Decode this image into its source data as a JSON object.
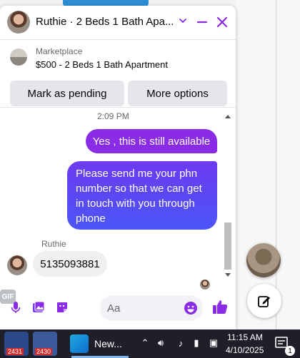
{
  "chat": {
    "title": "Ruthie · 2 Beds 1 Bath Apa...",
    "listing": {
      "source": "Marketplace",
      "title": "$500 - 2 Beds 1 Bath Apartment",
      "mark_pending_label": "Mark as pending",
      "more_options_label": "More options"
    },
    "timestamp": "2:09 PM",
    "messages": [
      {
        "direction": "outgoing",
        "text": "Yes , this is still available"
      },
      {
        "direction": "outgoing",
        "text": "Please send me your phn number so that we can get in touch with you through phone"
      },
      {
        "direction": "incoming",
        "sender": "Ruthie",
        "text": "5135093881"
      }
    ],
    "composer": {
      "placeholder": "Aa",
      "gif_label": "GIF"
    },
    "accent_color": "#8a2be6"
  },
  "taskbar": {
    "apps": [
      {
        "count": "2431"
      },
      {
        "count": "2430"
      },
      {
        "label": "New..."
      }
    ],
    "time": "11:15 AM",
    "date": "4/10/2025",
    "notification_count": "1"
  }
}
